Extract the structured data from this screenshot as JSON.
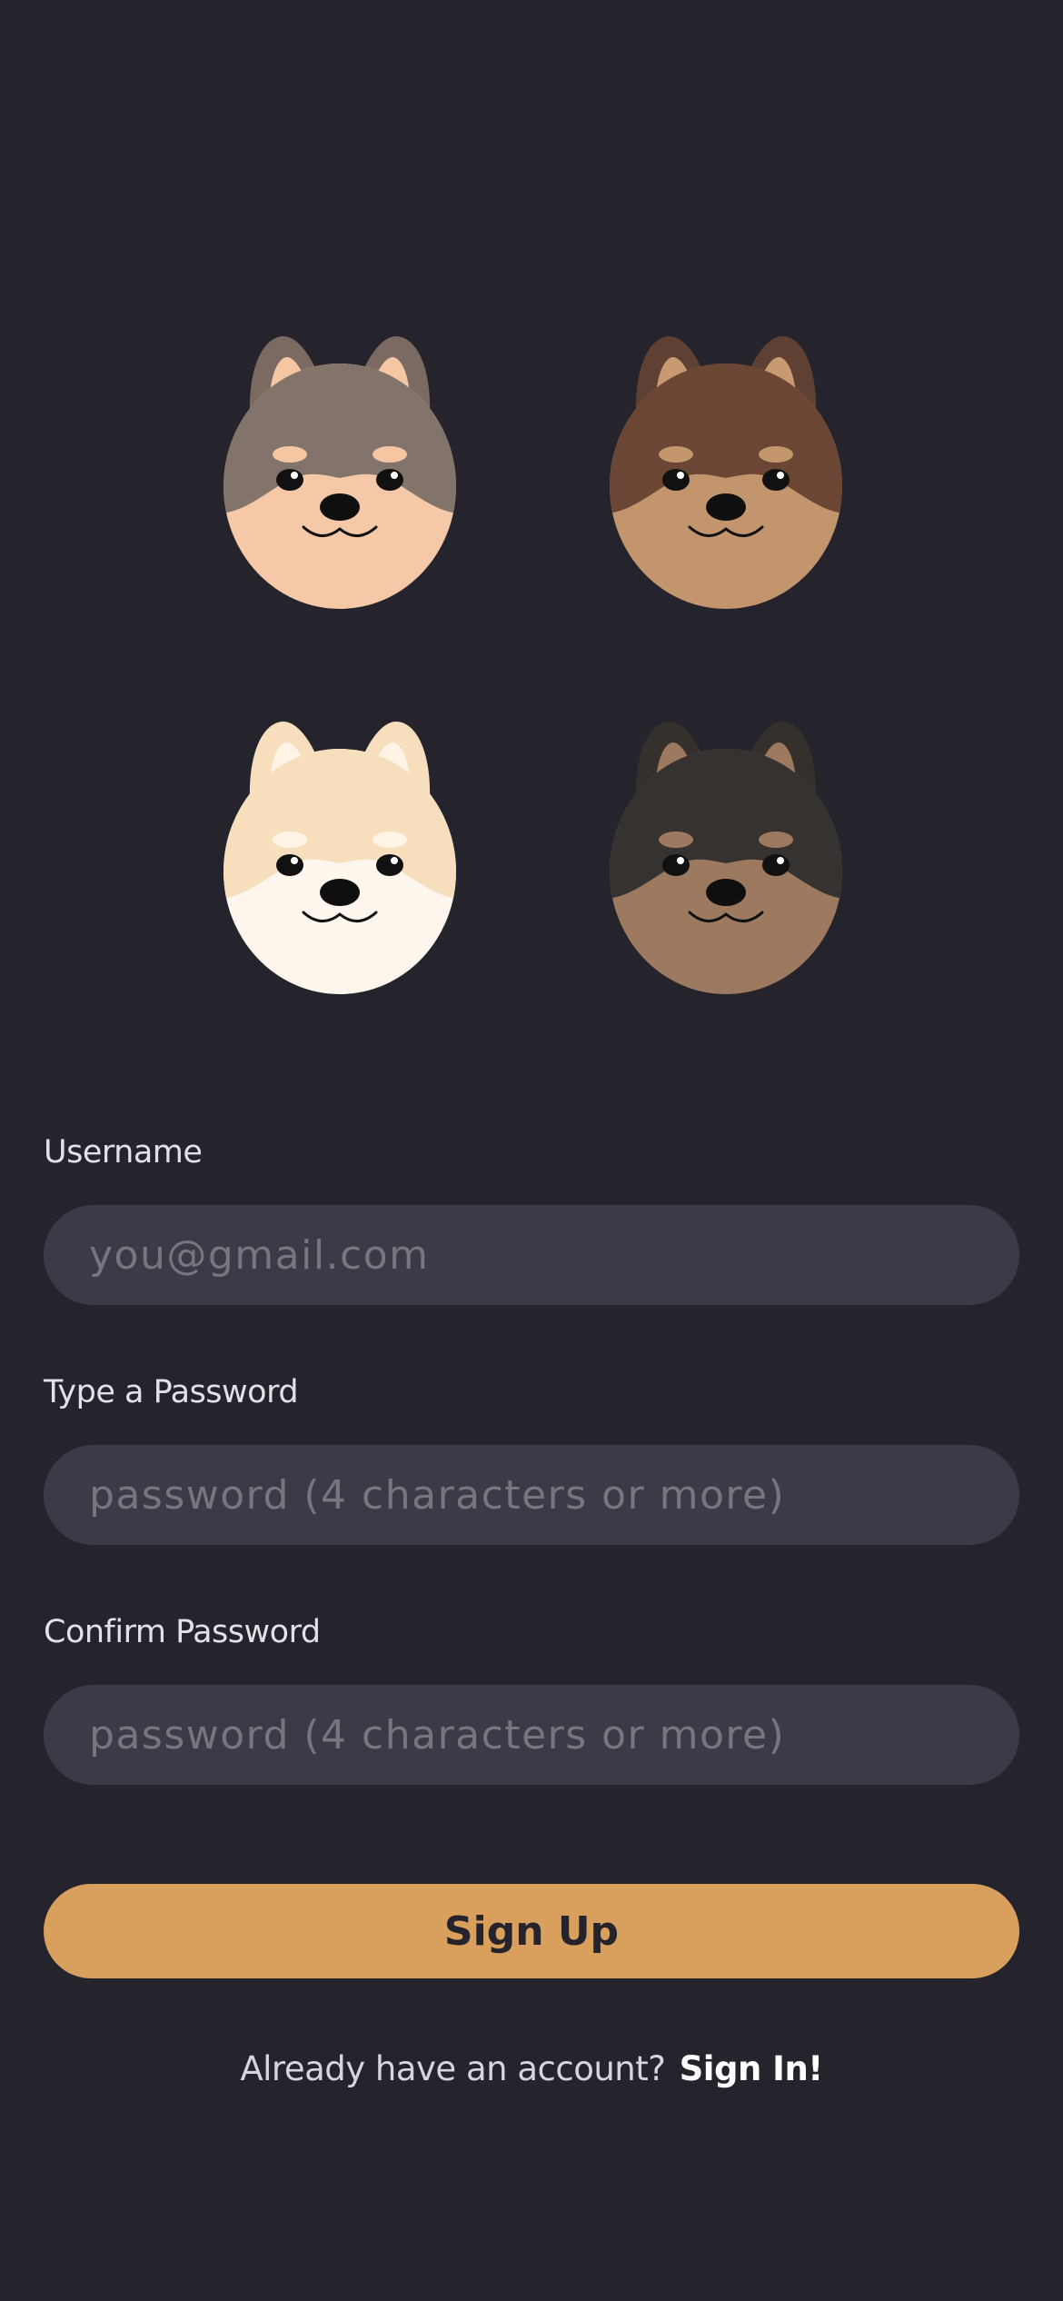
{
  "avatars": [
    {
      "icon": "dog-avatar-icon",
      "ear_outer": "#7a6a62",
      "ear_inner": "#f5c6a2",
      "fur_top": "#83746b",
      "fur_bottom": "#f5c9a7",
      "brow": "#f5c6a2"
    },
    {
      "icon": "dog-avatar-icon",
      "ear_outer": "#5e4133",
      "ear_inner": "#c79a72",
      "fur_top": "#6b4634",
      "fur_bottom": "#c3956d",
      "brow": "#c3956d"
    },
    {
      "icon": "dog-avatar-icon",
      "ear_outer": "#f7dfbe",
      "ear_inner": "#fff4e6",
      "fur_top": "#f7dfbe",
      "fur_bottom": "#fff7ed",
      "brow": "#fff4e6"
    },
    {
      "icon": "dog-avatar-icon",
      "ear_outer": "#35302c",
      "ear_inner": "#9d7a5f",
      "fur_top": "#363230",
      "fur_bottom": "#9d7a5f",
      "brow": "#9d7a5f"
    }
  ],
  "form": {
    "username_label": "Username",
    "username_placeholder": "you@gmail.com",
    "password_label": "Type a Password",
    "password_placeholder": "password (4 characters or more)",
    "confirm_label": "Confirm Password",
    "confirm_placeholder": "password (4 characters or more)"
  },
  "actions": {
    "signup_label": "Sign Up",
    "signin_prompt": "Already have an account?",
    "signin_label": "Sign In!"
  },
  "colors": {
    "background": "#25242d",
    "input_background": "#3b3a47",
    "accent": "#d9a05d",
    "text": "#e2e1e7"
  }
}
